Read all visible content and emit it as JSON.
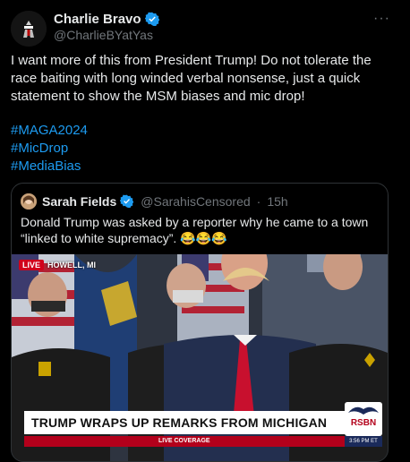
{
  "tweet": {
    "display_name": "Charlie Bravo",
    "handle": "@CharlieBYatYas",
    "more_label": "···",
    "text": "I want more of this from President Trump! Do not tolerate the race baiting with long winded verbal nonsense, just a quick statement to show the MSM biases and mic drop!",
    "hashtags": [
      "#MAGA2024",
      "#MicDrop",
      "#MediaBias"
    ],
    "verified_icon": "verified-badge-icon"
  },
  "quote": {
    "display_name": "Sarah Fields",
    "handle": "@SarahisCensored",
    "separator": "·",
    "time": "15h",
    "text": "Donald Trump was asked by a reporter why he came to a town “linked to white supremacy”. 😂😂😂"
  },
  "media": {
    "live_label": "LIVE",
    "location": "HOWELL, MI",
    "headline": "TRUMP WRAPS UP REMARKS FROM MICHIGAN",
    "ticker": "LIVE COVERAGE",
    "network": "RSBN",
    "time": "3:56 PM ET"
  },
  "colors": {
    "background": "#000000",
    "text": "#e7e9ea",
    "muted": "#71767b",
    "link": "#1d9bf0",
    "verified": "#1d9bf0",
    "border": "#2f3336"
  }
}
